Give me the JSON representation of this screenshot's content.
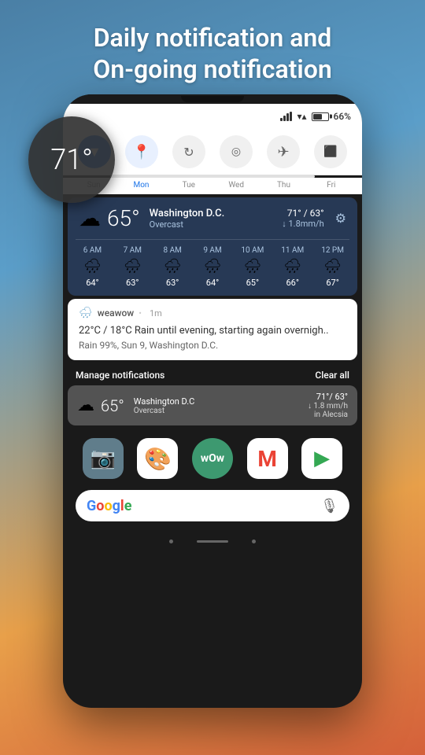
{
  "header": {
    "line1": "Daily notification and",
    "line2": "On-going notification"
  },
  "temp_circle": {
    "value": "71°"
  },
  "status_bar": {
    "battery_pct": "66%",
    "wifi": "▼▲",
    "signal": "|||"
  },
  "quick_settings": {
    "buttons": [
      {
        "icon": "▼",
        "style": "active-blue",
        "name": "dropdown-icon"
      },
      {
        "icon": "📍",
        "style": "active-light",
        "name": "location-icon"
      },
      {
        "icon": "↻",
        "style": "inactive",
        "name": "sync-icon"
      },
      {
        "icon": "◎",
        "style": "inactive",
        "name": "hotspot-icon"
      },
      {
        "icon": "✈",
        "style": "inactive",
        "name": "airplane-icon"
      },
      {
        "icon": "⬛",
        "style": "inactive",
        "name": "cast-icon"
      }
    ]
  },
  "calendar": {
    "days": [
      "Sun",
      "Mon",
      "Tue",
      "Wed",
      "Thu",
      "Fri"
    ]
  },
  "weather_card": {
    "temperature": "65°",
    "city": "Washington D.C.",
    "description": "Overcast",
    "high_low": "71° / 63°",
    "rain_rate": "↓ 1.8mm/h",
    "hourly": [
      {
        "time": "6 AM",
        "temp": "64°",
        "icon": "🌧"
      },
      {
        "time": "7 AM",
        "temp": "63°",
        "icon": "🌧"
      },
      {
        "time": "8 AM",
        "temp": "63°",
        "icon": "🌧"
      },
      {
        "time": "9 AM",
        "temp": "64°",
        "icon": "🌧"
      },
      {
        "time": "10 AM",
        "temp": "65°",
        "icon": "🌧"
      },
      {
        "time": "11 AM",
        "temp": "66°",
        "icon": "🌧"
      },
      {
        "time": "12 PM",
        "temp": "67°",
        "icon": "🌧"
      }
    ]
  },
  "notification": {
    "app_name": "weawow",
    "time": "1m",
    "body": "22°C / 18°C Rain until evening, starting again overnigh..",
    "sub": "Rain 99%, Sun 9, Washington D.C."
  },
  "manage_bar": {
    "label": "Manage notifications",
    "clear": "Clear all"
  },
  "collapsed_notif": {
    "temperature": "65°",
    "city": "Washington D.C",
    "desc": "Overcast",
    "hilo": "71°/ 63°",
    "rain": "↓ 1.8 mm/h",
    "by": "in Alecsia"
  },
  "home_apps": [
    {
      "name": "camera",
      "label": "📷"
    },
    {
      "name": "photos",
      "label": "🎨"
    },
    {
      "name": "wow",
      "label": "wOw"
    },
    {
      "name": "gmail",
      "label": "M"
    },
    {
      "name": "play",
      "label": "▶"
    }
  ],
  "search_bar": {
    "g": [
      "G",
      "o",
      "o",
      "g",
      "l",
      "e"
    ],
    "mic": "🎙"
  }
}
